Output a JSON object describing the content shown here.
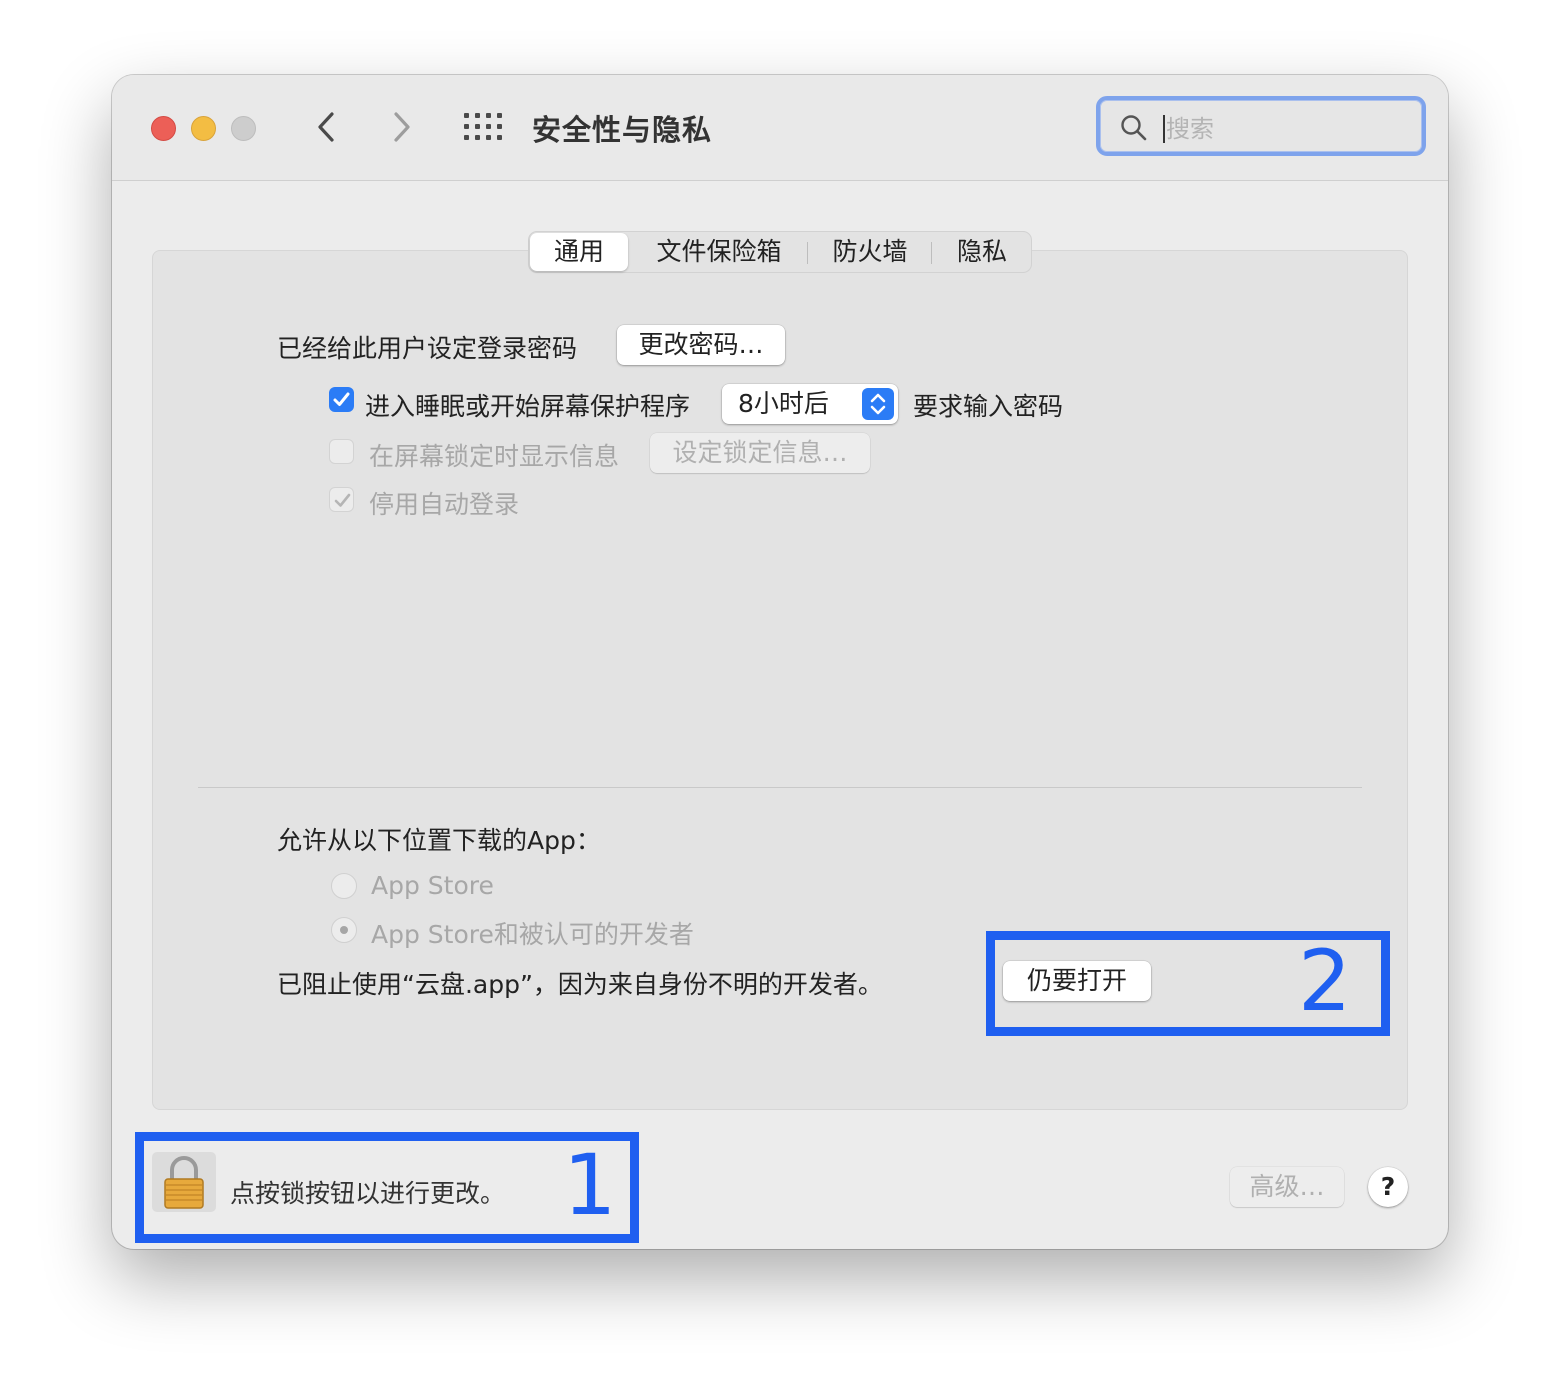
{
  "window": {
    "title": "安全性与隐私",
    "search_placeholder": "搜索"
  },
  "tabs": [
    {
      "label": "通用",
      "active": true
    },
    {
      "label": "文件保险箱",
      "active": false
    },
    {
      "label": "防火墙",
      "active": false
    },
    {
      "label": "隐私",
      "active": false
    }
  ],
  "general": {
    "password_set_label": "已经给此用户设定登录密码",
    "change_password_button": "更改密码…",
    "require_password": {
      "checked": true,
      "prefix": "进入睡眠或开始屏幕保护程序",
      "delay_value": "8小时后",
      "suffix": "要求输入密码"
    },
    "show_message": {
      "checked": false,
      "enabled": false,
      "label": "在屏幕锁定时显示信息",
      "button": "设定锁定信息…"
    },
    "disable_auto_login": {
      "checked": true,
      "enabled": false,
      "label": "停用自动登录"
    }
  },
  "downloads": {
    "heading": "允许从以下位置下载的App：",
    "options": [
      {
        "label": "App Store",
        "selected": false
      },
      {
        "label": "App Store和被认可的开发者",
        "selected": true
      }
    ],
    "blocked_message": "已阻止使用“云盘.app”，因为来自身份不明的开发者。",
    "open_anyway_button": "仍要打开"
  },
  "footer": {
    "lock_message": "点按锁按钮以进行更改。",
    "advanced_button": "高级…",
    "help_label": "?"
  },
  "annotations": [
    {
      "number": "1"
    },
    {
      "number": "2"
    }
  ],
  "colors": {
    "accent": "#2b7cf6",
    "annotation": "#1f5ff0",
    "close": "#ec5f57",
    "minimize": "#f3bd43"
  }
}
